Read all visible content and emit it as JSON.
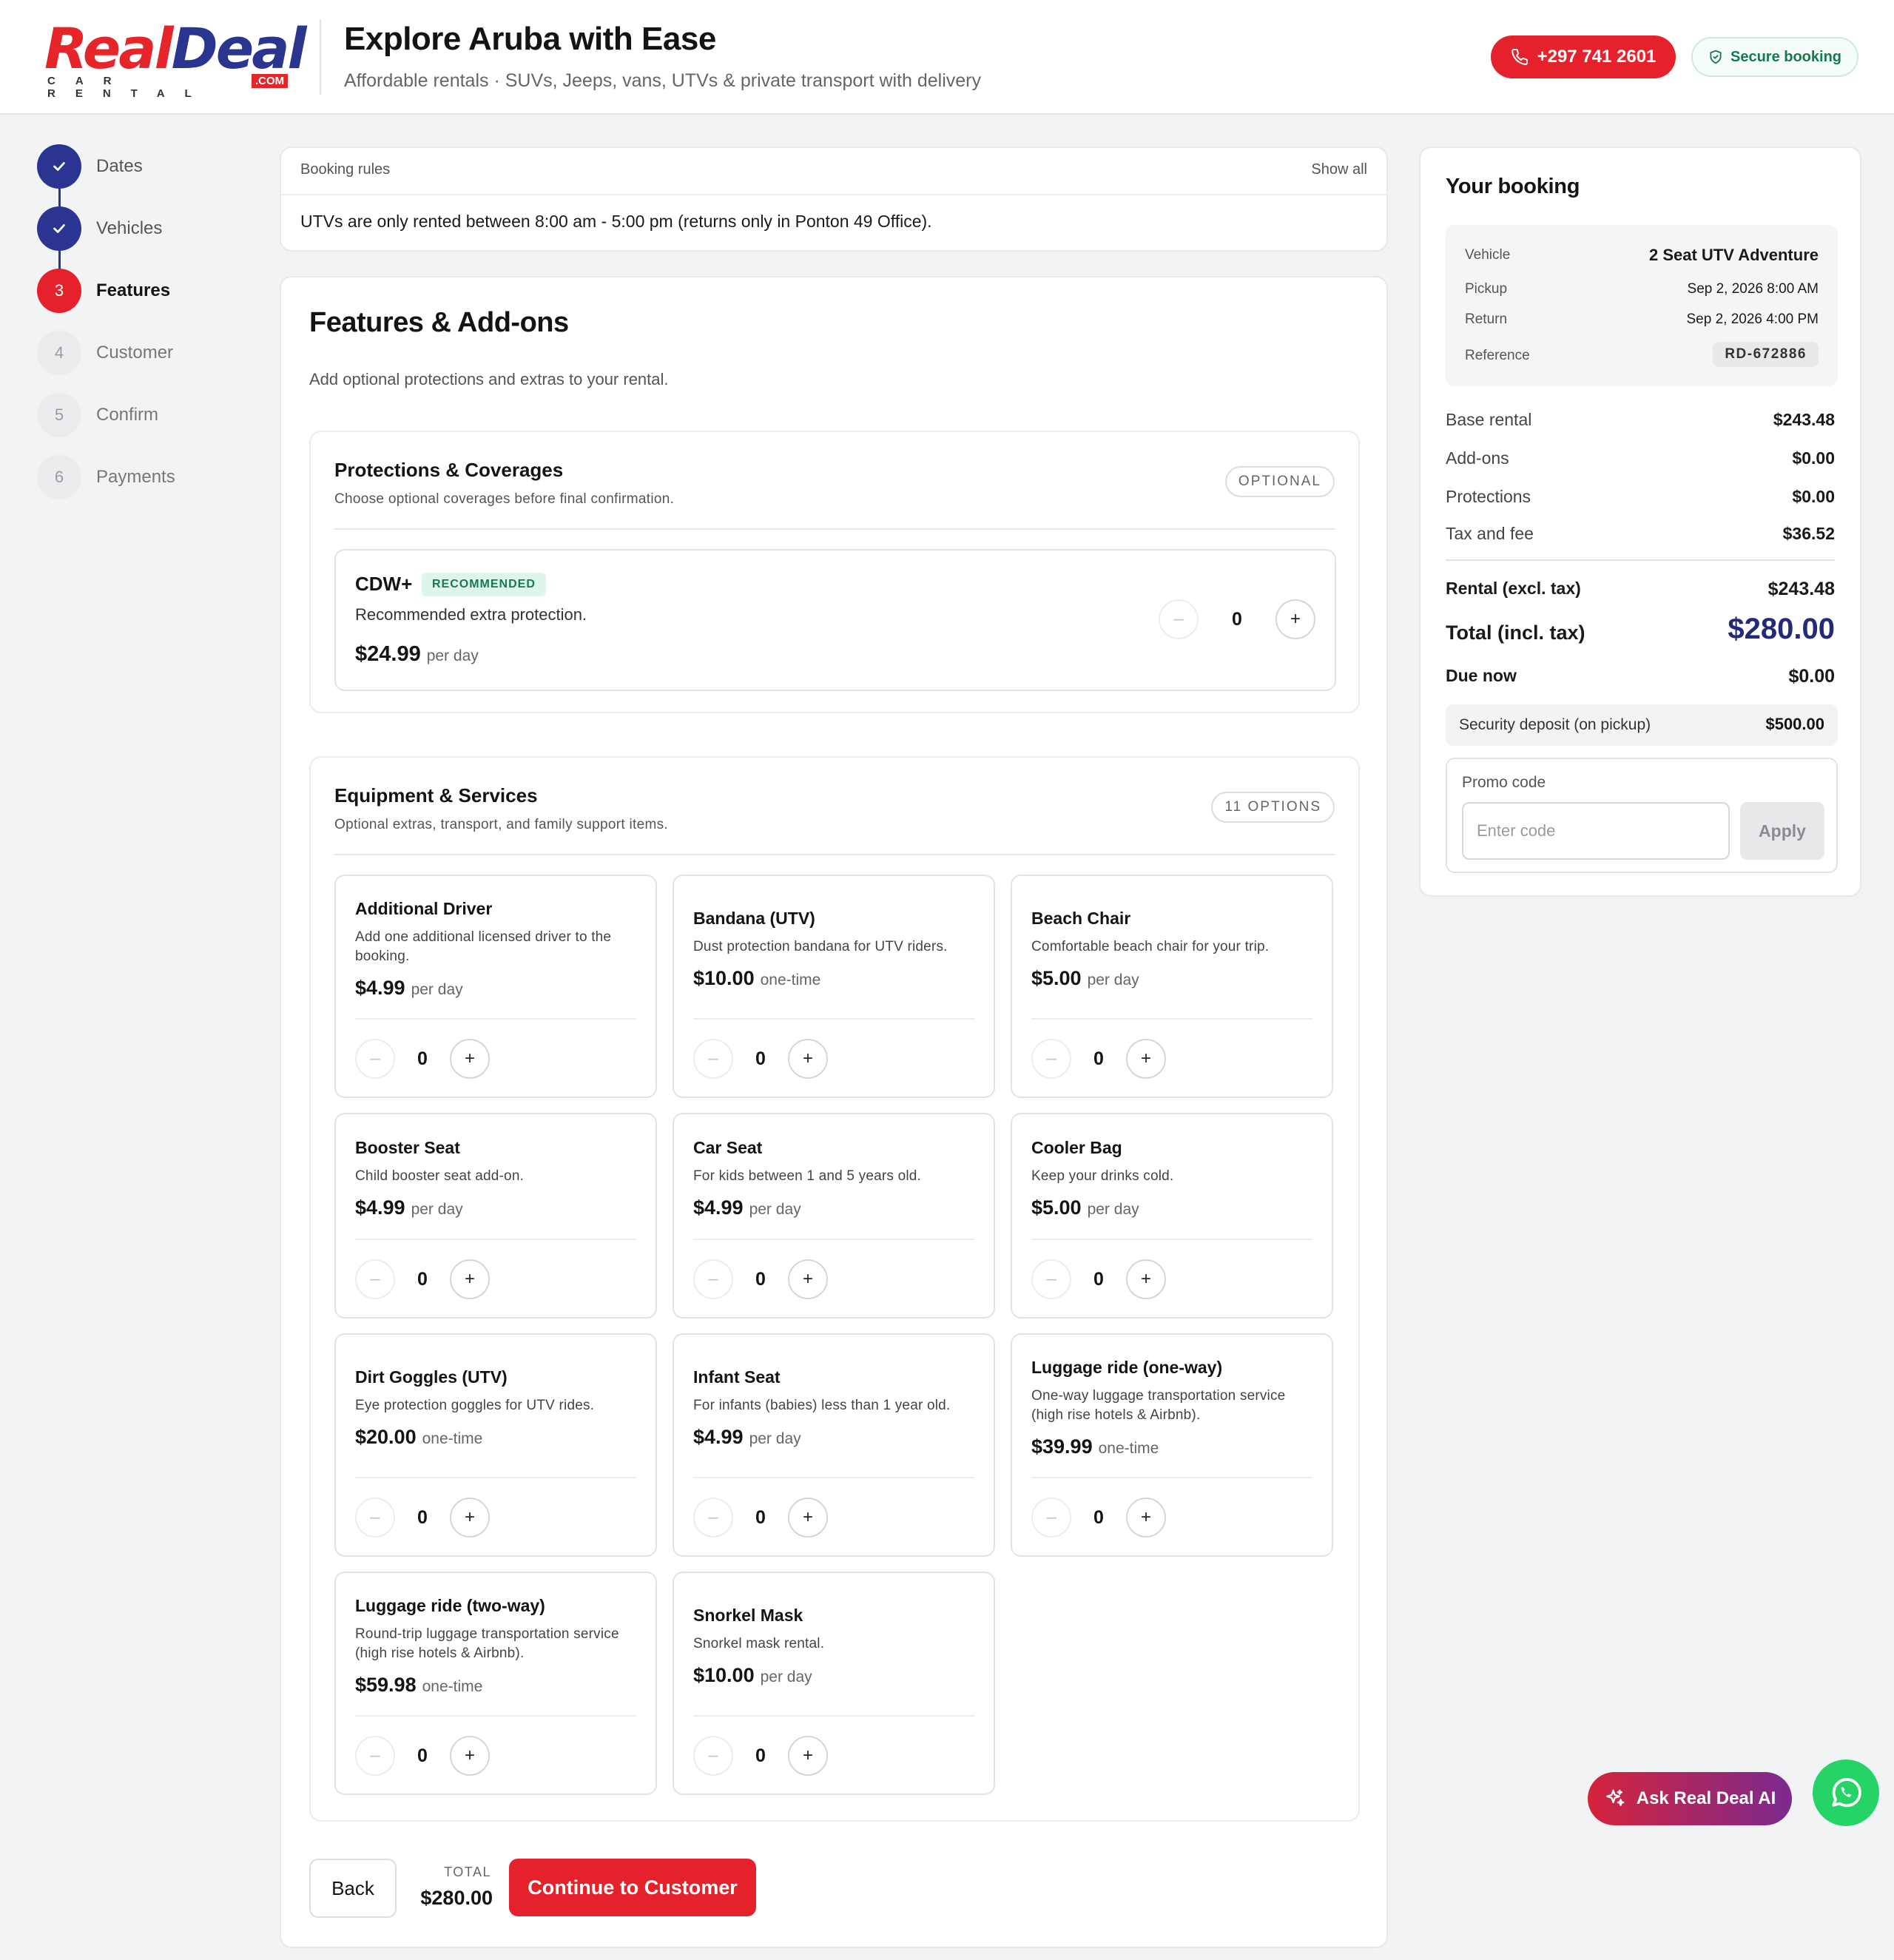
{
  "brand": {
    "logo_part1": "Real",
    "logo_part2": "Deal",
    "logo_sub": "CAR RENTAL",
    "logo_com": ".COM",
    "colors": {
      "red": "#e5222b",
      "navy": "#2b3591",
      "green": "#17794f"
    }
  },
  "header": {
    "title": "Explore Aruba with Ease",
    "subtitle": "Affordable rentals · SUVs, Jeeps, vans, UTVs & private transport with delivery",
    "phone": "+297 741 2601",
    "phone_icon": "phone-icon",
    "secure": "Secure booking",
    "secure_icon": "shield-icon"
  },
  "steps": [
    {
      "num": "1",
      "label": "Dates",
      "state": "done"
    },
    {
      "num": "2",
      "label": "Vehicles",
      "state": "done"
    },
    {
      "num": "3",
      "label": "Features",
      "state": "active"
    },
    {
      "num": "4",
      "label": "Customer",
      "state": "todo"
    },
    {
      "num": "5",
      "label": "Confirm",
      "state": "todo"
    },
    {
      "num": "6",
      "label": "Payments",
      "state": "todo"
    }
  ],
  "rules": {
    "heading": "Booking rules",
    "show_all": "Show all",
    "text": "UTVs are only rented between 8:00 am - 5:00 pm (returns only in Ponton 49 Office)."
  },
  "features": {
    "title": "Features & Add-ons",
    "subtitle": "Add optional protections and extras to your rental."
  },
  "protections": {
    "title": "Protections & Coverages",
    "subtitle": "Choose optional coverages before final confirmation.",
    "pill": "OPTIONAL",
    "item": {
      "name": "CDW+",
      "badge": "RECOMMENDED",
      "desc": "Recommended extra protection.",
      "price": "$24.99",
      "unit": "per day",
      "qty": "0"
    }
  },
  "equipment": {
    "title": "Equipment & Services",
    "subtitle": "Optional extras, transport, and family support items.",
    "pill": "11 OPTIONS",
    "items": [
      {
        "name": "Additional Driver",
        "desc": "Add one additional licensed driver to the booking.",
        "price": "$4.99",
        "unit": "per day",
        "qty": "0"
      },
      {
        "name": "Bandana (UTV)",
        "desc": "Dust protection bandana for UTV riders.",
        "price": "$10.00",
        "unit": "one-time",
        "qty": "0"
      },
      {
        "name": "Beach Chair",
        "desc": "Comfortable beach chair for your trip.",
        "price": "$5.00",
        "unit": "per day",
        "qty": "0"
      },
      {
        "name": "Booster Seat",
        "desc": "Child booster seat add-on.",
        "price": "$4.99",
        "unit": "per day",
        "qty": "0"
      },
      {
        "name": "Car Seat",
        "desc": "For kids between 1 and 5 years old.",
        "price": "$4.99",
        "unit": "per day",
        "qty": "0"
      },
      {
        "name": "Cooler Bag",
        "desc": "Keep your drinks cold.",
        "price": "$5.00",
        "unit": "per day",
        "qty": "0"
      },
      {
        "name": "Dirt Goggles (UTV)",
        "desc": "Eye protection goggles for UTV rides.",
        "price": "$20.00",
        "unit": "one-time",
        "qty": "0"
      },
      {
        "name": "Infant Seat",
        "desc": "For infants (babies) less than 1 year old.",
        "price": "$4.99",
        "unit": "per day",
        "qty": "0"
      },
      {
        "name": "Luggage ride (one-way)",
        "desc": "One-way luggage transportation service (high rise hotels & Airbnb).",
        "price": "$39.99",
        "unit": "one-time",
        "qty": "0"
      },
      {
        "name": "Luggage ride (two-way)",
        "desc": "Round-trip luggage transportation service (high rise hotels & Airbnb).",
        "price": "$59.98",
        "unit": "one-time",
        "qty": "0"
      },
      {
        "name": "Snorkel Mask",
        "desc": "Snorkel mask rental.",
        "price": "$10.00",
        "unit": "per day",
        "qty": "0"
      }
    ]
  },
  "footer": {
    "back": "Back",
    "total_label": "TOTAL",
    "total_value": "$280.00",
    "continue": "Continue to Customer"
  },
  "summary": {
    "title": "Your booking",
    "vehicle_label": "Vehicle",
    "vehicle": "2 Seat UTV Adventure",
    "pickup_label": "Pickup",
    "pickup": "Sep 2, 2026 8:00 AM",
    "return_label": "Return",
    "return": "Sep 2, 2026 4:00 PM",
    "reference_label": "Reference",
    "reference": "RD-672886",
    "base_label": "Base rental",
    "base": "$243.48",
    "addons_label": "Add-ons",
    "addons": "$0.00",
    "protections_label": "Protections",
    "protections": "$0.00",
    "tax_label": "Tax and fee",
    "tax": "$36.52",
    "rental_label": "Rental (excl. tax)",
    "rental": "$243.48",
    "total_label": "Total (incl. tax)",
    "total": "$280.00",
    "due_label": "Due now",
    "due": "$0.00",
    "deposit_label": "Security deposit (on pickup)",
    "deposit": "$500.00",
    "promo_label": "Promo code",
    "promo_placeholder": "Enter code",
    "apply": "Apply"
  },
  "floating": {
    "ai_label": "Ask Real Deal AI",
    "ai_icon": "sparkle-icon",
    "whatsapp_icon": "whatsapp-icon"
  }
}
